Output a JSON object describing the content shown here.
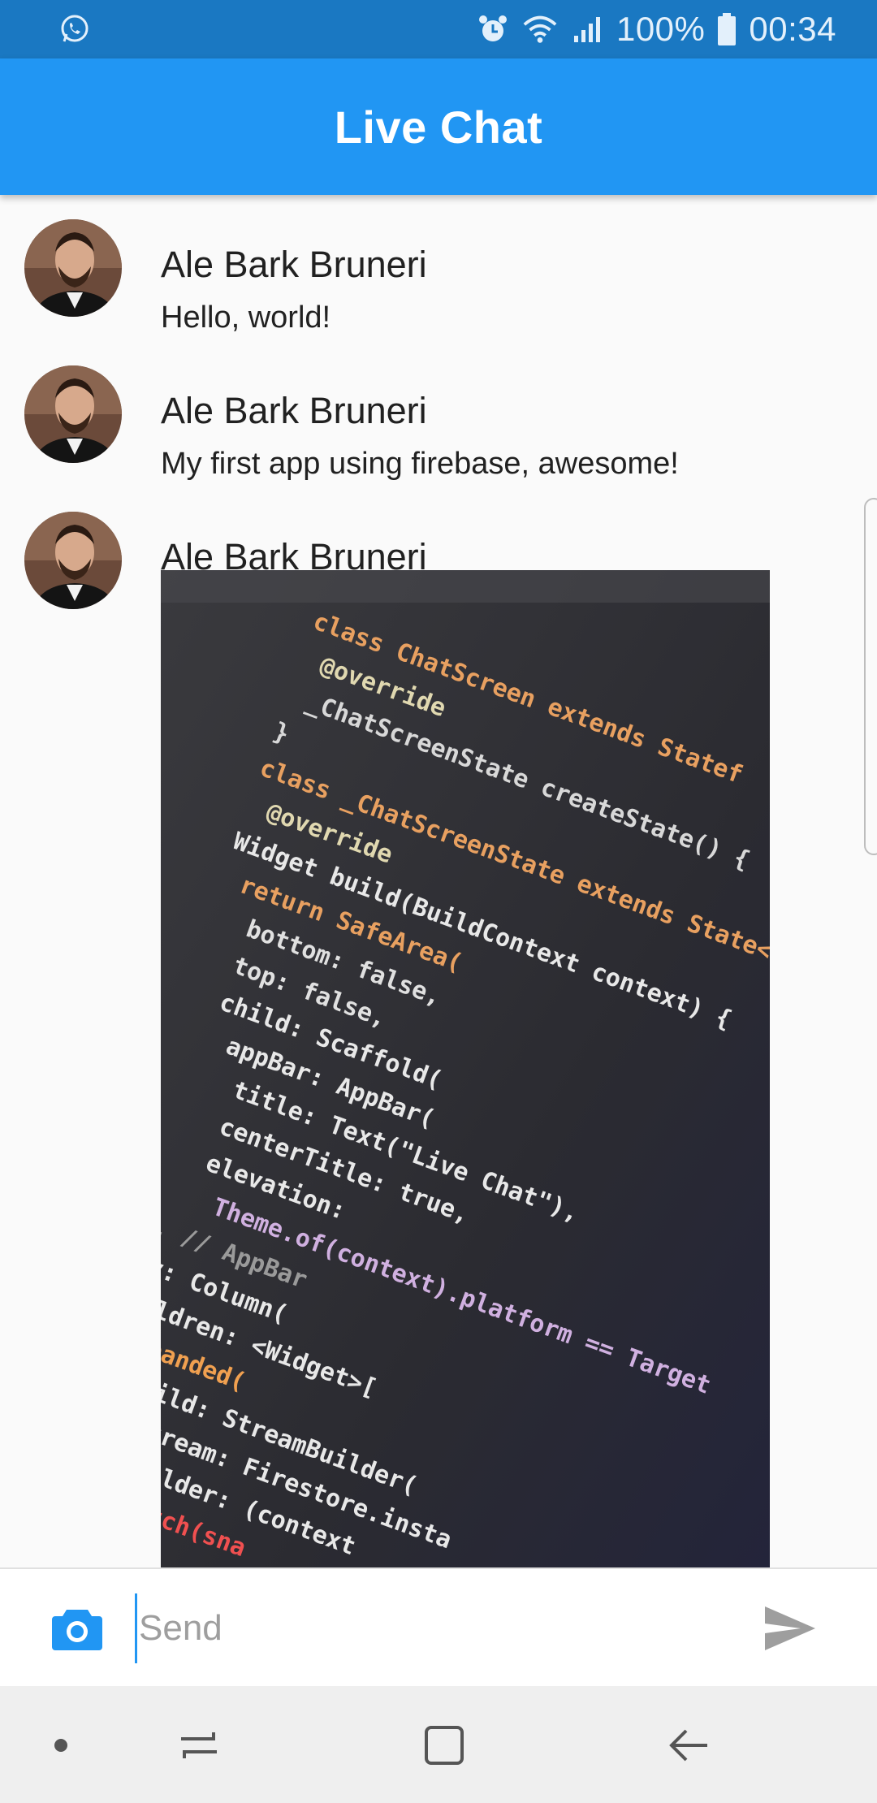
{
  "status_bar": {
    "battery": "100%",
    "time": "00:34",
    "icons": [
      "whatsapp-icon",
      "alarm-icon",
      "wifi-icon",
      "signal-icon",
      "battery-icon"
    ]
  },
  "app_bar": {
    "title": "Live Chat"
  },
  "messages": [
    {
      "sender": "Ale Bark Bruneri",
      "text": "Hello, world!"
    },
    {
      "sender": "Ale Bark Bruneri",
      "text": "My first app using firebase, awesome!"
    },
    {
      "sender": "Ale Bark Bruneri",
      "image": "code-photo"
    }
  ],
  "code_photo_lines": [
    "class ChatScreen extends Statef",
    "@override",
    "_ChatScreenState createState() {",
    "}",
    "class _ChatScreenState extends State<",
    "@override",
    "Widget build(BuildContext context) {",
    "return SafeArea(",
    "bottom: false,",
    "top: false,",
    "child: Scaffold(",
    "appBar: AppBar(",
    "title: Text(\"Live Chat\"),",
    "centerTitle: true,",
    "elevation:",
    "Theme.of(context).platform == Target",
    "), // AppBar",
    "body: Column(",
    "children: <Widget>[",
    "Expanded(",
    "child: StreamBuilder(",
    "stream: Firestore.insta",
    "builder: (context",
    "switch(sna"
  ],
  "composer": {
    "placeholder": "Send"
  },
  "colors": {
    "primary": "#2196f3",
    "status_bar": "#1a78c2",
    "background": "#fafafa"
  }
}
